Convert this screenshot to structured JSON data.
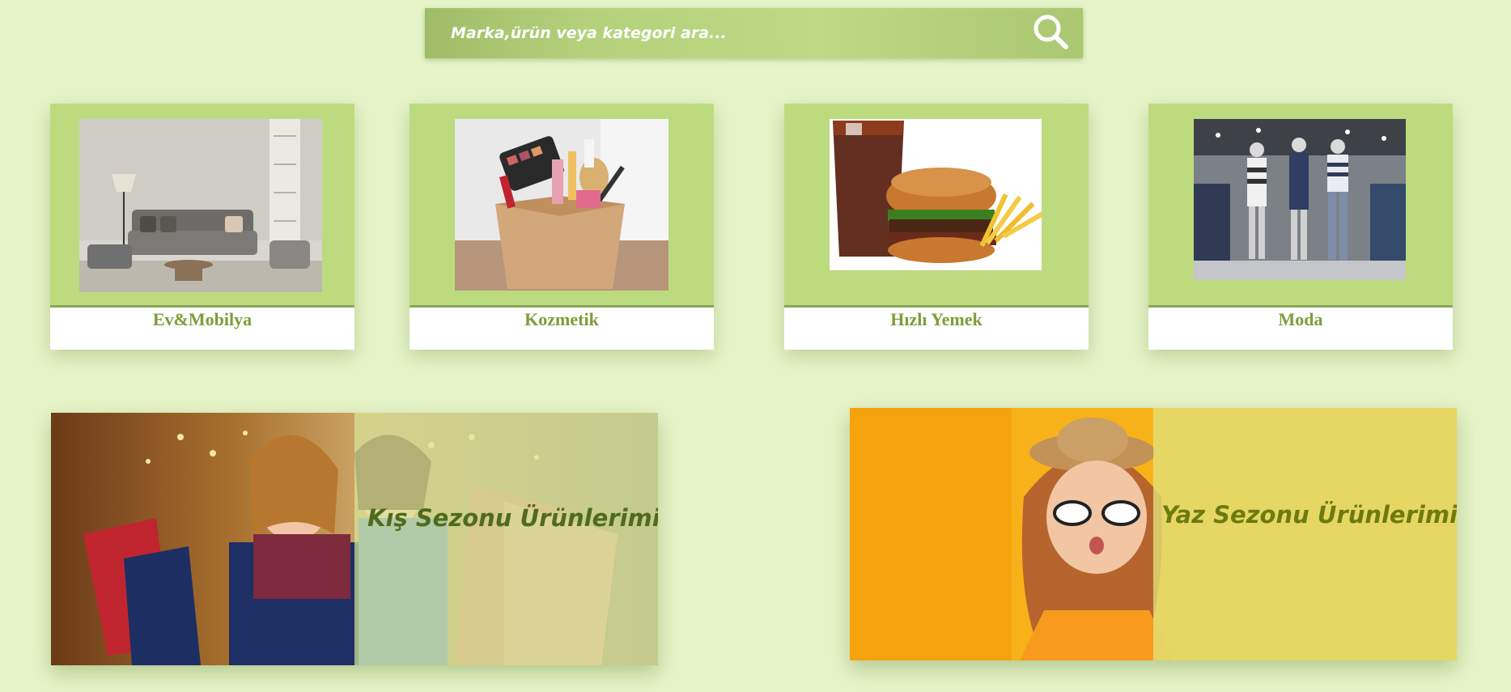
{
  "search": {
    "placeholder": "Marka,ürün veya kategori ara...",
    "icon": "search-icon"
  },
  "categories": [
    {
      "label": "Ev&Mobilya",
      "image": "living-room-furniture"
    },
    {
      "label": "Kozmetik",
      "image": "cosmetics-box"
    },
    {
      "label": "Hızlı Yemek",
      "image": "burger-cola-fries"
    },
    {
      "label": "Moda",
      "image": "clothing-store-mannequins"
    }
  ],
  "banners": [
    {
      "label": "Kış Sezonu Ürünlerimiz",
      "image": "women-shopping-bags"
    },
    {
      "label": "Yaz Sezonu Ürünlerimiz",
      "image": "woman-sunglasses-hat"
    }
  ],
  "colors": {
    "background": "#e6f3c8",
    "card_green": "#bcdb7f",
    "label_green": "#7e9d38",
    "banner_text_dark": "#4f6b1d",
    "banner_summer_text": "#6d7a10"
  }
}
